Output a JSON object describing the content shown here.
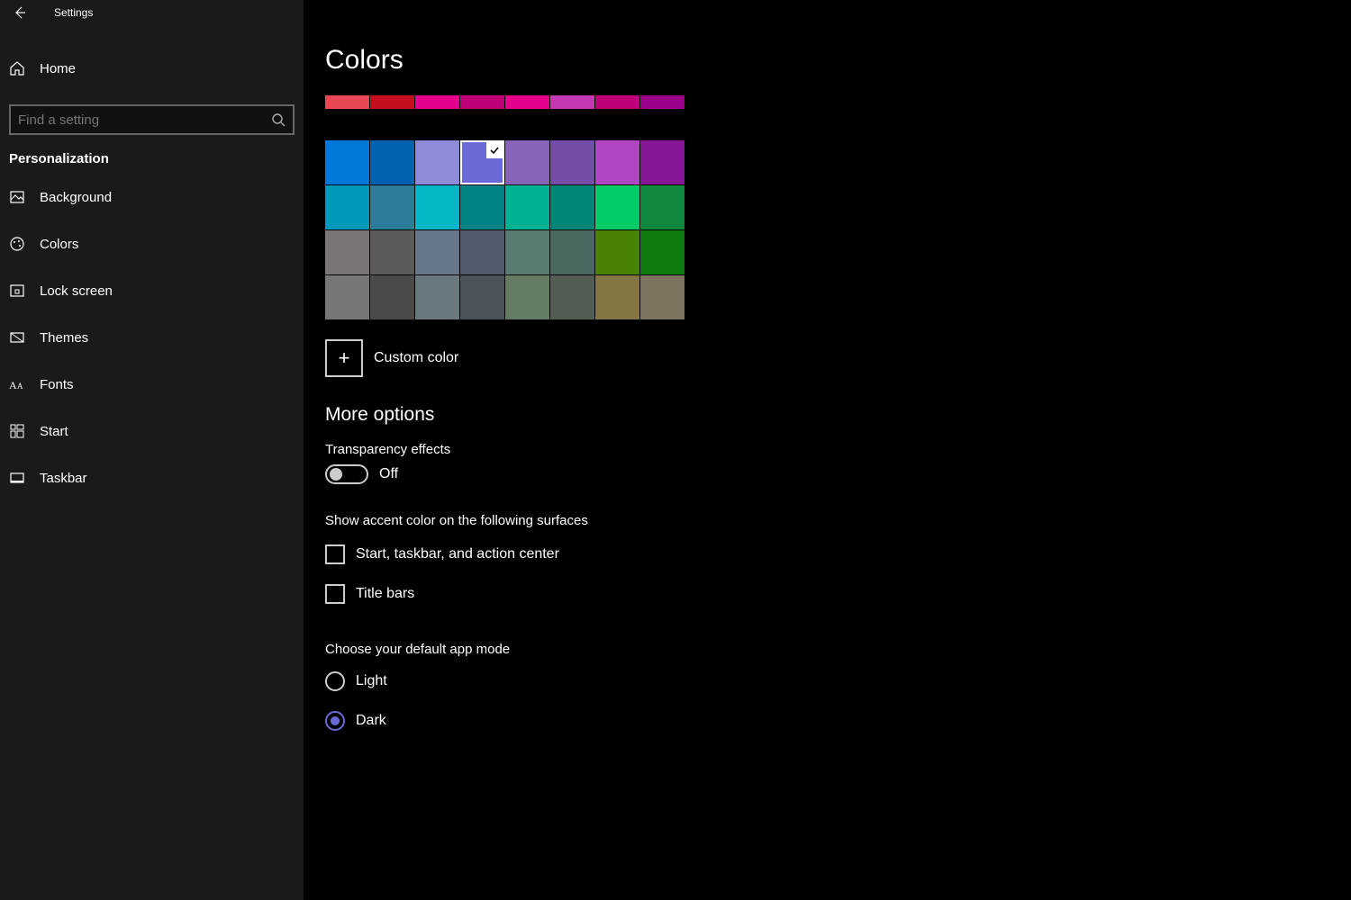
{
  "titlebar": {
    "title": "Settings"
  },
  "nav": {
    "home": "Home",
    "search_placeholder": "Find a setting",
    "section": "Personalization",
    "items": [
      {
        "id": "background",
        "label": "Background"
      },
      {
        "id": "colors",
        "label": "Colors"
      },
      {
        "id": "lockscreen",
        "label": "Lock screen"
      },
      {
        "id": "themes",
        "label": "Themes"
      },
      {
        "id": "fonts",
        "label": "Fonts"
      },
      {
        "id": "start",
        "label": "Start"
      },
      {
        "id": "taskbar",
        "label": "Taskbar"
      }
    ]
  },
  "page": {
    "title": "Colors",
    "custom_color_label": "Custom color",
    "more_options": "More options",
    "transparency_label": "Transparency effects",
    "transparency_state": "Off",
    "accent_surface_label": "Show accent color on the following surfaces",
    "accent_opt1": "Start, taskbar, and action center",
    "accent_opt2": "Title bars",
    "app_mode_label": "Choose your default app mode",
    "mode_light": "Light",
    "mode_dark": "Dark"
  },
  "colors": {
    "selected_index": 11,
    "row0": [
      "#e74856",
      "#c50f1f",
      "#e3008c",
      "#bf0077",
      "#e3008c",
      "#c239b3",
      "#bf0077",
      "#9a0089"
    ],
    "rows": [
      [
        "#0078d7",
        "#0063b1",
        "#8e8cd8",
        "#6b69d6",
        "#8764b8",
        "#744da9",
        "#b146c2",
        "#881798"
      ],
      [
        "#0099bc",
        "#2d7d9a",
        "#00b7c3",
        "#038387",
        "#00b294",
        "#018574",
        "#00cc6a",
        "#10893e"
      ],
      [
        "#7a7574",
        "#5d5a58",
        "#68768a",
        "#515c6b",
        "#567c73",
        "#486860",
        "#498205",
        "#107c10"
      ],
      [
        "#767676",
        "#4c4a48",
        "#69797e",
        "#4a5459",
        "#647c64",
        "#525e54",
        "#847545",
        "#7e735f"
      ]
    ]
  }
}
